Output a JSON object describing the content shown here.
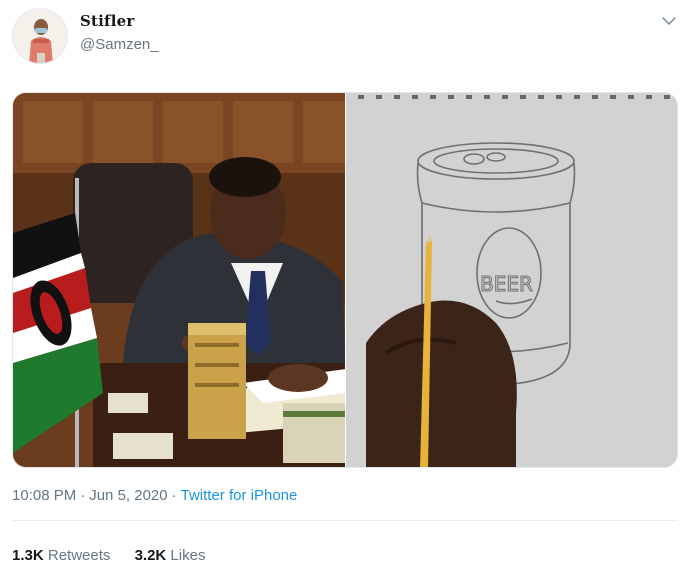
{
  "author": {
    "display_name": "Stifler",
    "handle": "@Samzen_"
  },
  "media": {
    "left_image": "man-signing-document-at-desk-photo",
    "right_image": "beer-can-pencil-drawing-photo",
    "drawing_label": "BEER"
  },
  "meta": {
    "time": "10:08 PM",
    "separator": "·",
    "date": "Jun 5, 2020",
    "source": "Twitter for iPhone"
  },
  "stats": {
    "retweets_count": "1.3K",
    "retweets_label": "Retweets",
    "likes_count": "3.2K",
    "likes_label": "Likes"
  },
  "colors": {
    "link": "#1b95e0",
    "muted": "#657786",
    "text": "#14171a",
    "divider": "#e6ecf0"
  },
  "icons": {
    "caret": "chevron-down-icon"
  }
}
